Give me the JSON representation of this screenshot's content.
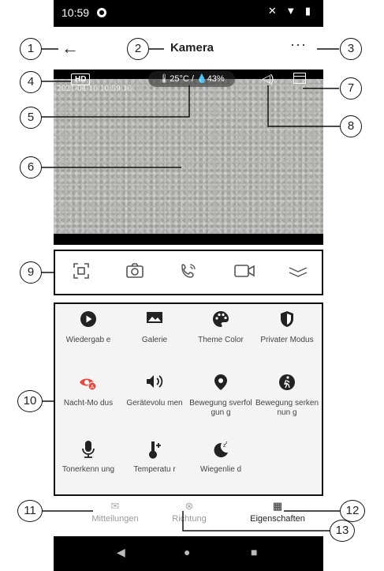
{
  "status_bar": {
    "time": "10:59",
    "icons": "✕ ▼ ▮"
  },
  "header": {
    "title": "Kamera",
    "back_icon": "←",
    "more_icon": "···"
  },
  "video": {
    "quality_badge": "HD",
    "timestamp": "2021-04-16 10:59:16",
    "environment": "🌡25°C / 💧43%"
  },
  "controls": [
    "screenshot",
    "camera",
    "call",
    "record",
    "expand"
  ],
  "features": [
    {
      "icon": "play-icon",
      "glyph": "▶",
      "label": "Wiedergab e"
    },
    {
      "icon": "gallery-icon",
      "glyph": "▰",
      "label": "Galerie"
    },
    {
      "icon": "palette-icon",
      "glyph": "✿",
      "label": "Theme Color"
    },
    {
      "icon": "shield-icon",
      "glyph": "◐",
      "label": "Privater Modus"
    },
    {
      "icon": "night-mode-icon",
      "glyph": "◉",
      "label": "Nacht-Mo dus"
    },
    {
      "icon": "speaker-icon",
      "glyph": "◀)",
      "label": "Gerätevolu men"
    },
    {
      "icon": "location-icon",
      "glyph": "●",
      "label": "Bewegung sverfolgun g"
    },
    {
      "icon": "motion-icon",
      "glyph": "☻",
      "label": "Bewegung serkennun g"
    },
    {
      "icon": "microphone-icon",
      "glyph": "♪",
      "label": "Tonerkenn ung"
    },
    {
      "icon": "thermometer-icon",
      "glyph": "🌡",
      "label": "Temperatu r"
    },
    {
      "icon": "moon-icon",
      "glyph": "☾",
      "label": "Wiegenlie d"
    }
  ],
  "tabs": [
    {
      "label": "Mitteilungen",
      "glyph": "✉"
    },
    {
      "label": "Richtung",
      "glyph": "⊗"
    },
    {
      "label": "Eigenschaften",
      "glyph": "▦"
    }
  ],
  "callouts": [
    "1",
    "2",
    "3",
    "4",
    "5",
    "6",
    "7",
    "8",
    "9",
    "10",
    "11",
    "12",
    "13"
  ],
  "colors": {
    "accent": "#e8453c",
    "frame": "#111111"
  }
}
